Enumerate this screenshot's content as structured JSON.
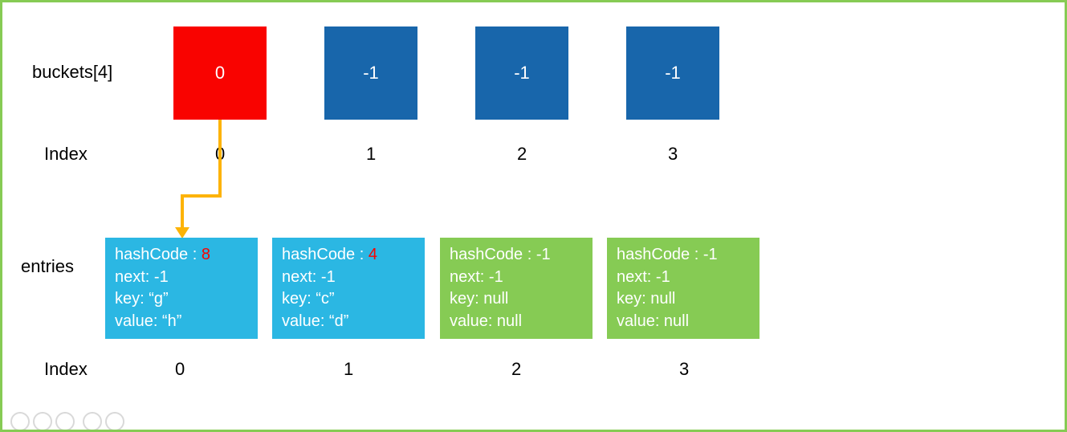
{
  "labels": {
    "buckets": "buckets[4]",
    "entries": "entries",
    "index": "Index"
  },
  "buckets": [
    {
      "value": "0",
      "index": "0"
    },
    {
      "value": "-1",
      "index": "1"
    },
    {
      "value": "-1",
      "index": "2"
    },
    {
      "value": "-1",
      "index": "3"
    }
  ],
  "entries": [
    {
      "hashCodeLabel": "hashCode : ",
      "hashCodeValue": "8",
      "next": "next: -1",
      "key": "key: “g”",
      "value": "value: “h”",
      "index": "0",
      "highlight": true
    },
    {
      "hashCodeLabel": "hashCode : ",
      "hashCodeValue": "4",
      "next": "next: -1",
      "key": "key: “c”",
      "value": "value: “d”",
      "index": "1",
      "highlight": true
    },
    {
      "hashCodeLabel": "hashCode : ",
      "hashCodeValue": "-1",
      "next": "next: -1",
      "key": "key: null",
      "value": "value: null",
      "index": "2",
      "highlight": false
    },
    {
      "hashCodeLabel": "hashCode : ",
      "hashCodeValue": "-1",
      "next": "next: -1",
      "key": "key: null",
      "value": "value: null",
      "index": "3",
      "highlight": false
    }
  ],
  "colors": {
    "border": "#86cb54",
    "red": "#f90300",
    "blue": "#1866ab",
    "cyan": "#2bb7e3",
    "green": "#86cb54",
    "arrow": "#fdb306"
  }
}
